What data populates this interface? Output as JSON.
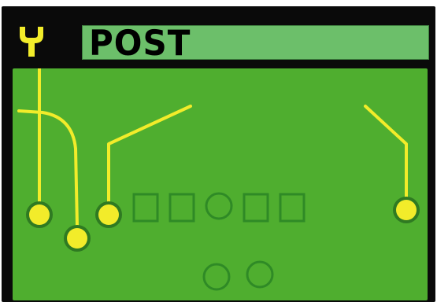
{
  "play": {
    "name": "POST",
    "formation_icon": "y-formation-icon"
  },
  "colors": {
    "frame": "#0a0a0a",
    "title_bar": "#6cbf6a",
    "field": "#4fae2f",
    "route": "#f2ec2a",
    "receiver": "#f2ec2a",
    "receiver_ring": "#2f7a22",
    "lineman_outline": "#2f8a26"
  }
}
